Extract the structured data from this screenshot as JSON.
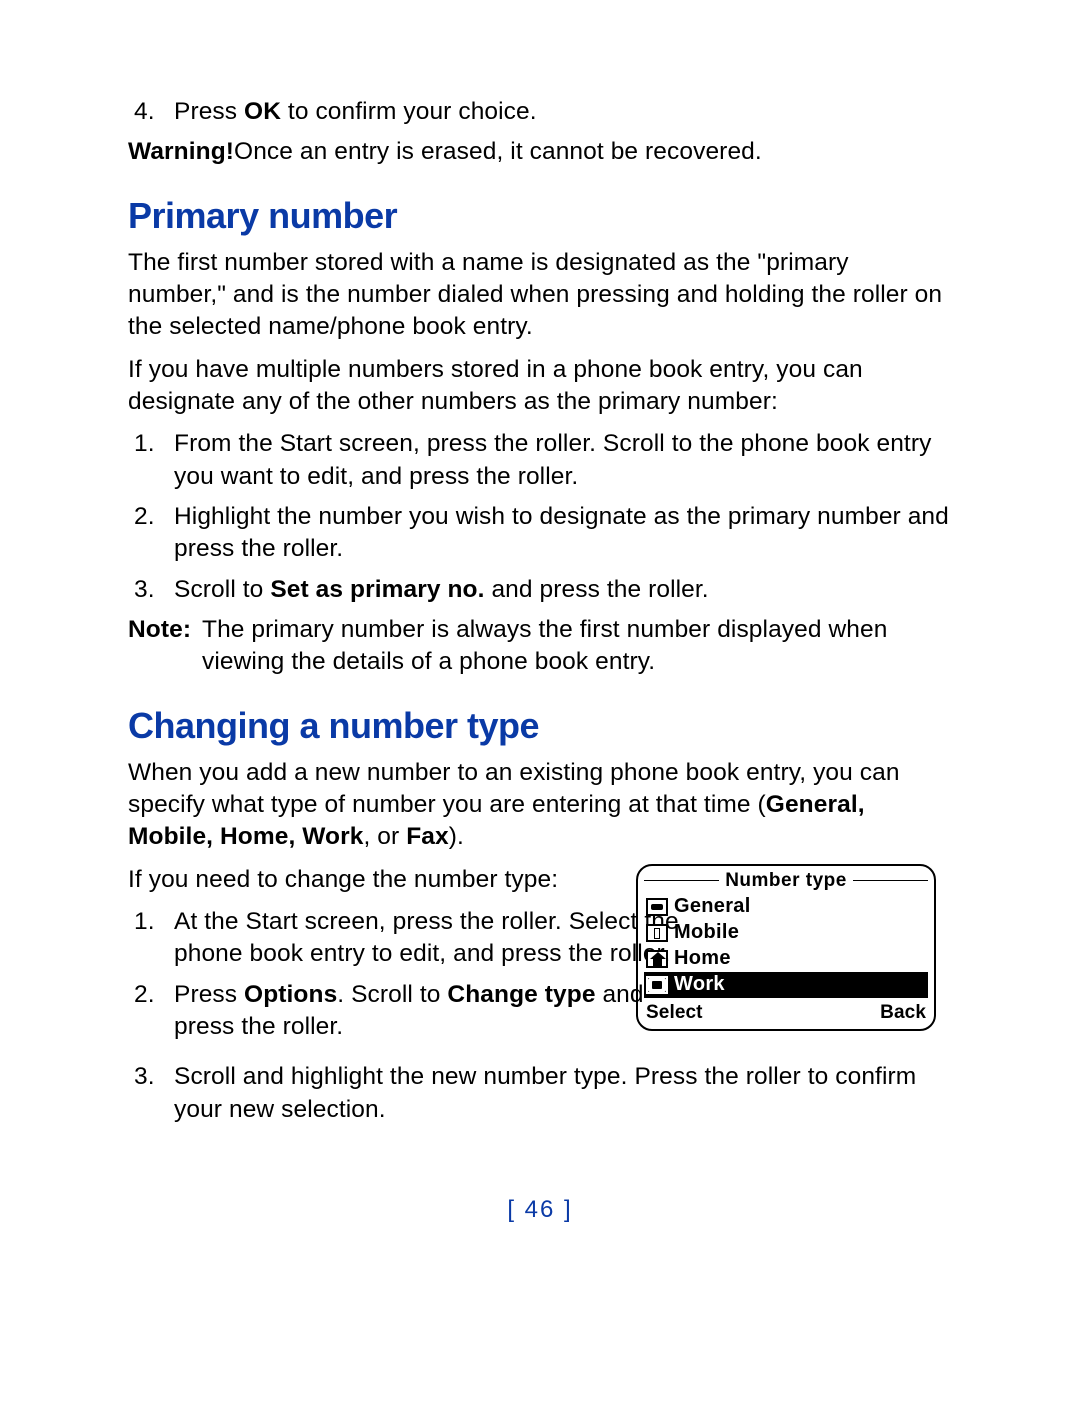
{
  "top": {
    "step4_num": "4.",
    "step4_prefix": "Press ",
    "step4_bold": "OK",
    "step4_suffix": " to confirm your choice.",
    "warning_label": "Warning!  ",
    "warning_text": "Once an entry is erased, it cannot be recovered."
  },
  "primary": {
    "heading": "Primary number",
    "p1": "The first number stored with a name is designated as the \"primary number,\" and is the number dialed when pressing and holding the roller on the selected name/phone book entry.",
    "p2": "If you have multiple numbers stored in a phone book entry, you can designate any of the other numbers as the primary number:",
    "steps": {
      "n1": "1.",
      "s1": "From the Start screen, press the roller. Scroll to the phone book entry you want to edit, and press the roller.",
      "n2": "2.",
      "s2": "Highlight the number you wish to designate as the primary number and press the roller.",
      "n3": "3.",
      "s3_prefix": "Scroll to ",
      "s3_bold": "Set as primary no.",
      "s3_suffix": " and press the roller."
    },
    "note_label": "Note:",
    "note_text": "The primary number is always the first number displayed when viewing the details of a phone book entry."
  },
  "changing": {
    "heading": "Changing a number type",
    "p1_prefix": "When you add a new number to an existing phone book entry, you can specify what type of number you are entering at that time (",
    "p1_bold": "General, Mobile, Home, Work",
    "p1_mid": ", or ",
    "p1_bold2": "Fax",
    "p1_suffix": ").",
    "p2": "If you need to change the number type:",
    "steps": {
      "n1": "1.",
      "s1": "At the Start screen, press the roller. Select the phone book entry to edit, and press the roller.",
      "n2": "2.",
      "s2_prefix": "Press ",
      "s2_bold1": "Options",
      "s2_mid": ". Scroll to ",
      "s2_bold2": "Change type",
      "s2_suffix": " and press the roller.",
      "n3": "3.",
      "s3": "Scroll and highlight the new number type. Press the roller to confirm your new selection."
    }
  },
  "phone": {
    "title": "Number type",
    "items": {
      "general": "General",
      "mobile": "Mobile",
      "home": "Home",
      "work": "Work"
    },
    "soft_left": "Select",
    "soft_right": "Back"
  },
  "page_number": "[ 46 ]"
}
